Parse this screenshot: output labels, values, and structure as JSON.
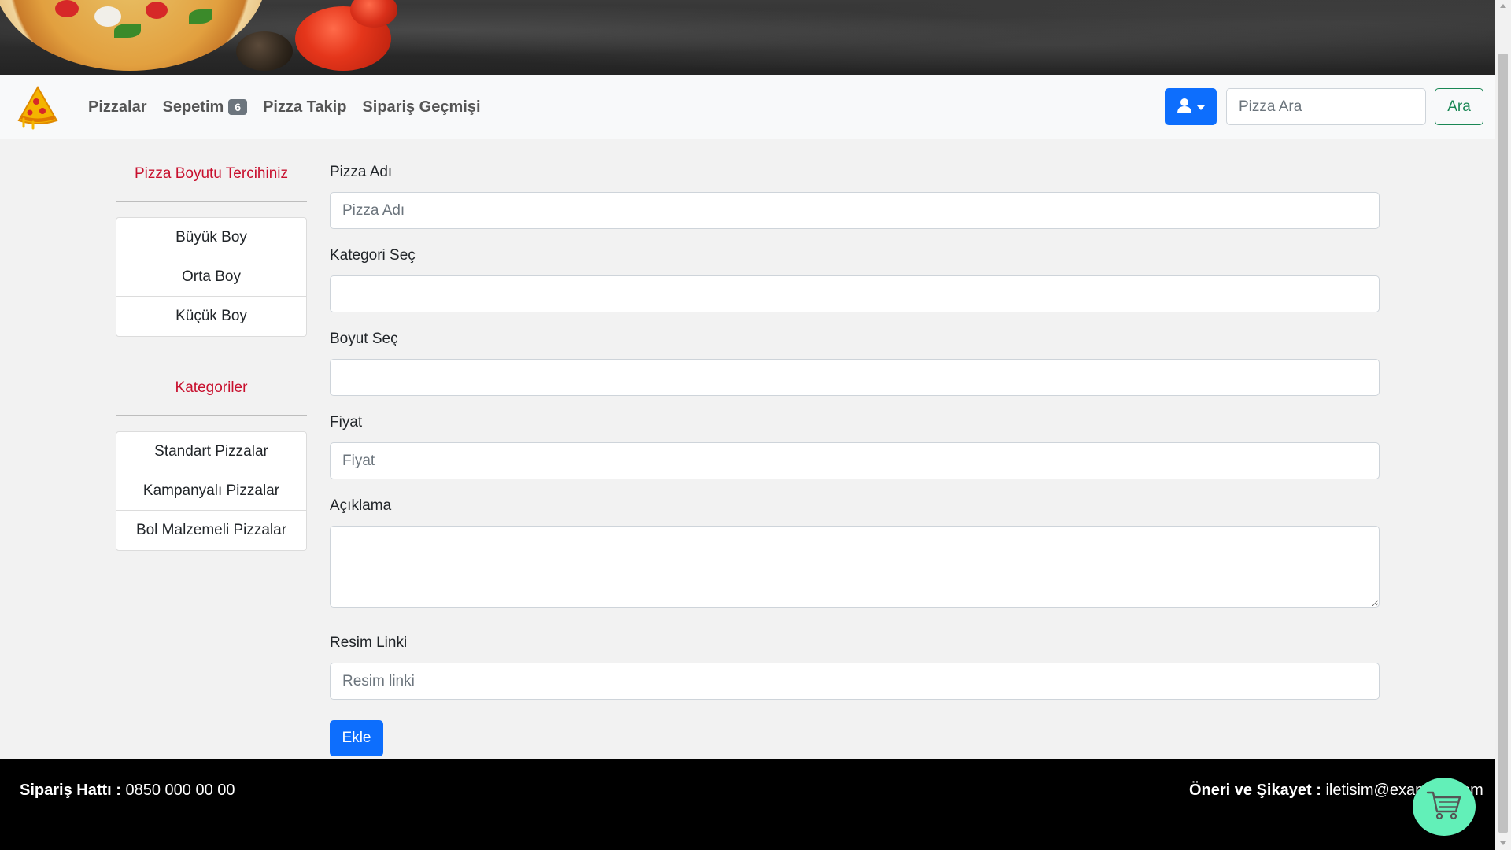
{
  "navbar": {
    "links": {
      "pizzalar": "Pizzalar",
      "sepetim": "Sepetim",
      "sepetim_badge": "6",
      "pizza_takip": "Pizza Takip",
      "siparis_gecmisi": "Sipariş Geçmişi"
    },
    "search": {
      "placeholder": "Pizza Ara",
      "button": "Ara"
    }
  },
  "sidebar": {
    "size_heading": "Pizza Boyutu Tercihiniz",
    "sizes": [
      "Büyük Boy",
      "Orta Boy",
      "Küçük Boy"
    ],
    "category_heading": "Kategoriler",
    "categories": [
      "Standart Pizzalar",
      "Kampanyalı Pizzalar",
      "Bol Malzemeli Pizzalar"
    ]
  },
  "form": {
    "name": {
      "label": "Pizza Adı",
      "placeholder": "Pizza Adı"
    },
    "category": {
      "label": "Kategori Seç",
      "value": ""
    },
    "size": {
      "label": "Boyut Seç",
      "value": ""
    },
    "price": {
      "label": "Fiyat",
      "placeholder": "Fiyat"
    },
    "description": {
      "label": "Açıklama",
      "value": ""
    },
    "image": {
      "label": "Resim Linki",
      "placeholder": "Resim linki"
    },
    "submit": "Ekle"
  },
  "footer": {
    "order_label": "Sipariş Hattı :",
    "order_phone": "0850 000 00 00",
    "feedback_label": "Öneri ve Şikayet :",
    "feedback_email": "iletisim@example.com"
  },
  "colors": {
    "primary": "#0d6efd",
    "success": "#198754",
    "sidebar_heading": "#c8102e",
    "cart_fab": "#62f0b8",
    "footer_bg": "#000000"
  },
  "icons": {
    "brand": "pizza-slice-icon",
    "user": "user-icon",
    "cart": "shopping-cart-icon"
  }
}
